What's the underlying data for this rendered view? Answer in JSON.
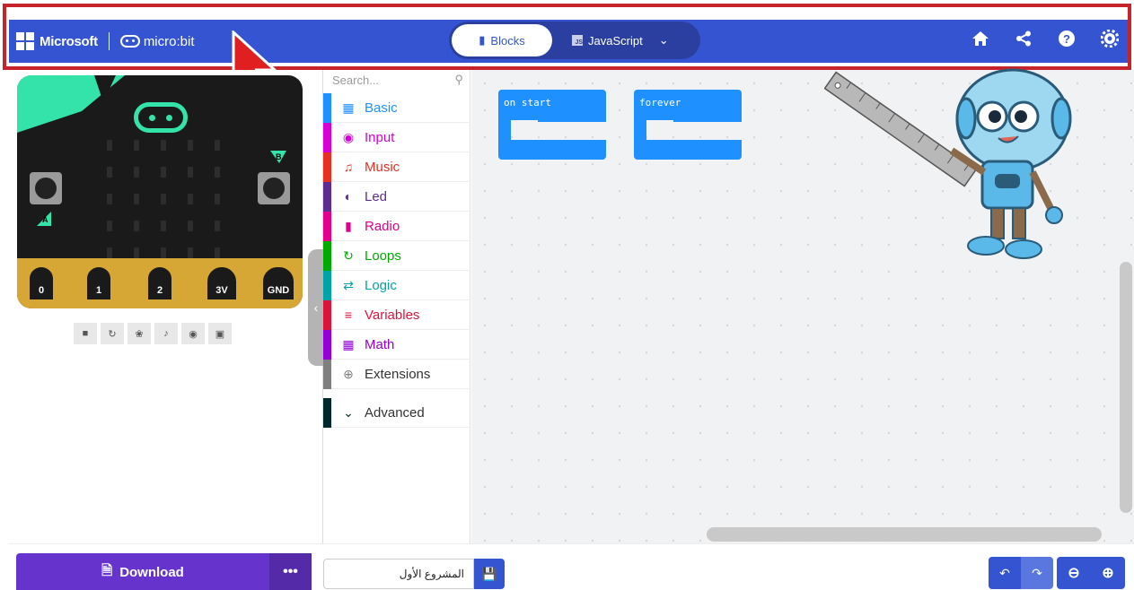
{
  "header": {
    "brand_ms": "Microsoft",
    "brand_mb": "micro:bit",
    "tab_blocks": "Blocks",
    "tab_js": "JavaScript",
    "icons": [
      "home-icon",
      "share-icon",
      "help-icon",
      "settings-icon"
    ]
  },
  "simulator": {
    "pins": [
      "0",
      "1",
      "2",
      "3V",
      "GND"
    ],
    "button_a": "A",
    "button_b": "B",
    "controls": [
      "stop-icon",
      "restart-icon",
      "debug-icon",
      "sound-icon",
      "screenshot-icon",
      "fullscreen-icon"
    ]
  },
  "toolbox": {
    "search_placeholder": "Search...",
    "categories": [
      {
        "label": "Basic",
        "color": "#1E90FF"
      },
      {
        "label": "Input",
        "color": "#D400D4"
      },
      {
        "label": "Music",
        "color": "#E63022"
      },
      {
        "label": "Led",
        "color": "#5C2D91"
      },
      {
        "label": "Radio",
        "color": "#E3008C"
      },
      {
        "label": "Loops",
        "color": "#00AA00"
      },
      {
        "label": "Logic",
        "color": "#00A4A6"
      },
      {
        "label": "Variables",
        "color": "#DC143C"
      },
      {
        "label": "Math",
        "color": "#9400D3"
      },
      {
        "label": "Extensions",
        "color": "#7F7F7F"
      },
      {
        "label": "Advanced",
        "color": "#00272B"
      }
    ]
  },
  "workspace": {
    "block_on_start": "on start",
    "block_forever": "forever"
  },
  "bottom": {
    "download_label": "Download",
    "project_name": "المشروع الأول"
  },
  "colors": {
    "header": "#3454D1",
    "highlight": "#C7232B",
    "download": "#6633CC"
  }
}
